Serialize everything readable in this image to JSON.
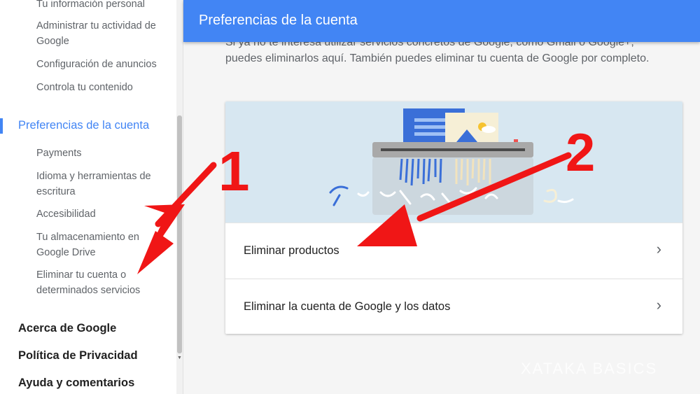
{
  "sidebar": {
    "partial_top": "Tu información personal",
    "sub_items_1": [
      "Administrar tu actividad de Google",
      "Configuración de anuncios",
      "Controla tu contenido"
    ],
    "active_section": "Preferencias de la cuenta",
    "sub_items_2": [
      "Payments",
      "Idioma y herramientas de escritura",
      "Accesibilidad",
      "Tu almacenamiento en Google Drive",
      "Eliminar tu cuenta o determinados servicios"
    ],
    "sections": [
      "Acerca de Google",
      "Política de Privacidad",
      "Ayuda y comentarios"
    ]
  },
  "header": {
    "title": "Preferencias de la cuenta"
  },
  "main": {
    "intro_cut": "Si ya no te interesa utilizar servicios concretos de Google, como Gmail o Google+,",
    "intro": "puedes eliminarlos aquí. También puedes eliminar tu cuenta de Google por completo.",
    "rows": [
      {
        "label": "Eliminar productos",
        "chevron": "›"
      },
      {
        "label": "Eliminar la cuenta de Google y los datos",
        "chevron": "›"
      }
    ]
  },
  "annotations": {
    "one": "1",
    "two": "2"
  },
  "watermark": "XATAKA BASICS",
  "colors": {
    "accent": "#4285f4",
    "arrow": "#f01616",
    "hero_bg": "#d7e7f1"
  },
  "icons": {
    "chevron": "chevron-right-icon",
    "illustration": "shredder-illustration"
  }
}
